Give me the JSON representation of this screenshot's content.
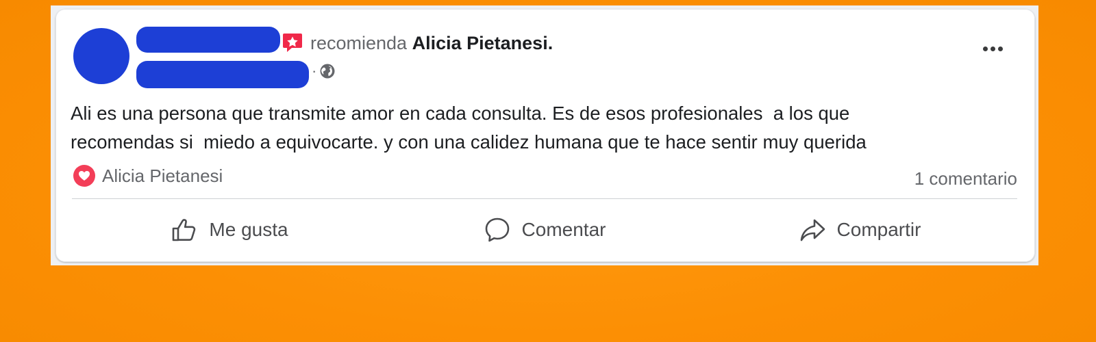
{
  "post": {
    "action_verb": "recomienda",
    "page_name": "Alicia Pietanesi.",
    "meta_separator": "·",
    "lines": [
      "Ali es una persona que transmite amor en cada consulta. Es de esos profesionales  a los que",
      "recomendas si  miedo a equivocarte. y con una calidez humana que te hace sentir muy querida"
    ]
  },
  "icons": {
    "recommend": "recommend-star-icon",
    "audience": "globe-icon",
    "more": "more-options-icon",
    "reaction": "love-reaction-icon",
    "like": "thumbs-up-icon",
    "comment": "comment-bubble-icon",
    "share": "share-arrow-icon"
  },
  "reactions": {
    "name": "Alicia Pietanesi"
  },
  "stats": {
    "comments": "1 comentario"
  },
  "actions": {
    "like": "Me gusta",
    "comment": "Comentar",
    "share": "Compartir"
  },
  "colors": {
    "background": "#fc8f04",
    "redaction": "#1d3fd6",
    "recommend_icon": "#f02849",
    "love": "#f33e58"
  }
}
